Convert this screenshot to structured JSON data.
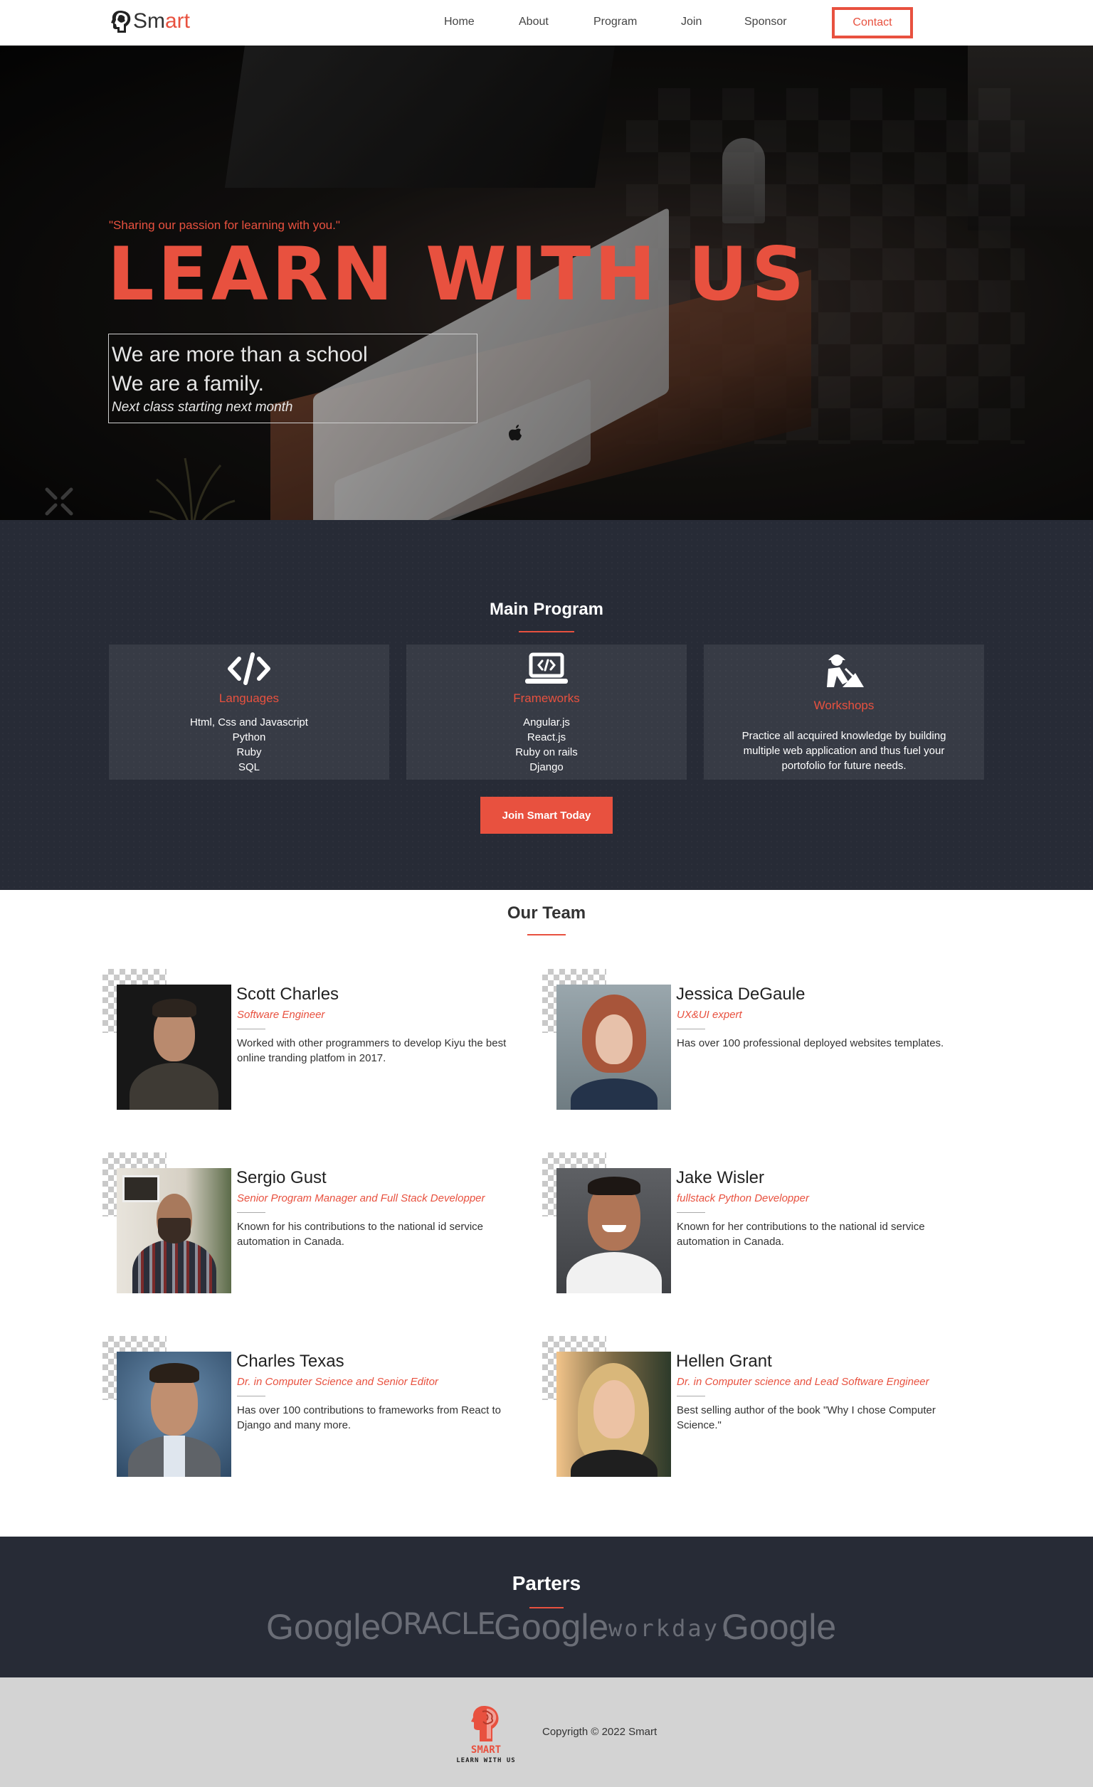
{
  "nav": {
    "logo_prefix": "Sm",
    "logo_suffix": "art",
    "links": [
      "Home",
      "About",
      "Program",
      "Join",
      "Sponsor"
    ],
    "contact": "Contact"
  },
  "hero": {
    "tagline": "\"Sharing our passion for learning with you.\"",
    "title": "LEARN WITH US",
    "line1": "We are more than a school",
    "line2": "We are a family.",
    "line3": "Next class starting next month"
  },
  "program": {
    "title": "Main Program",
    "cards": [
      {
        "title": "Languages",
        "items": [
          "Html, Css and Javascript",
          "Python",
          "Ruby",
          "SQL"
        ],
        "icon": "code-icon"
      },
      {
        "title": "Frameworks",
        "items": [
          "Angular.js",
          "React.js",
          "Ruby on rails",
          "Django"
        ],
        "icon": "laptop-code-icon"
      },
      {
        "title": "Workshops",
        "text": "Practice all acquired knowledge by building multiple web application and thus fuel your portofolio for future needs.",
        "icon": "worker-icon"
      }
    ],
    "cta": "Join Smart Today"
  },
  "team": {
    "title": "Our Team",
    "members": [
      {
        "name": "Scott Charles",
        "role": "Software Engineer",
        "desc": "Worked with other programmers to develop Kiyu the best online tranding platfom in 2017."
      },
      {
        "name": "Jessica DeGaule",
        "role": "UX&UI expert",
        "desc": "Has over 100 professional deployed websites templates."
      },
      {
        "name": "Sergio Gust",
        "role": "Senior Program Manager and Full Stack Developper",
        "desc": "Known for his contributions to the national id service automation in Canada."
      },
      {
        "name": "Jake Wisler",
        "role": "fullstack Python Developper",
        "desc": "Known for her contributions to the national id service automation in Canada."
      },
      {
        "name": "Charles Texas",
        "role": "Dr. in Computer Science and Senior Editor",
        "desc": "Has over 100 contributions to frameworks from React to Django and many more."
      },
      {
        "name": "Hellen Grant",
        "role": "Dr. in Computer science and Lead Software Engineer",
        "desc": "Best selling author of the book \"Why I chose Computer Science.\""
      }
    ]
  },
  "partners": {
    "title": "Parters",
    "logos": [
      "Google",
      "ORACLE",
      "Google",
      "workday.",
      "Google"
    ]
  },
  "footer": {
    "brand": "SMART",
    "sub": "LEARN WITH US",
    "copyright": "Copyrigth © 2022 Smart"
  },
  "colors": {
    "accent": "#e8513f",
    "dark": "#272b36",
    "footer": "#d3d3d3"
  }
}
